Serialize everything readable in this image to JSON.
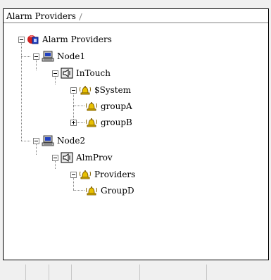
{
  "header": {
    "title": "Alarm Providers"
  },
  "tree": [
    {
      "id": "root",
      "label": "Alarm Providers",
      "icon": "alarm-providers-icon"
    },
    {
      "id": "node1",
      "label": "Node1",
      "icon": "computer-icon"
    },
    {
      "id": "intouch",
      "label": "InTouch",
      "icon": "provider-speaker-icon"
    },
    {
      "id": "system",
      "label": "$System",
      "icon": "alarm-bell-icon"
    },
    {
      "id": "groupA",
      "label": "groupA",
      "icon": "alarm-bell-icon"
    },
    {
      "id": "groupB",
      "label": "groupB",
      "icon": "alarm-bell-icon"
    },
    {
      "id": "node2",
      "label": "Node2",
      "icon": "computer-icon"
    },
    {
      "id": "almprov",
      "label": "AlmProv",
      "icon": "provider-speaker-icon"
    },
    {
      "id": "providers",
      "label": "Providers",
      "icon": "alarm-bell-icon"
    },
    {
      "id": "groupD",
      "label": "GroupD",
      "icon": "alarm-bell-icon"
    }
  ],
  "colors": {
    "bell": "#e8c000",
    "accent": "#2040c0",
    "alarm_red": "#d02020"
  }
}
